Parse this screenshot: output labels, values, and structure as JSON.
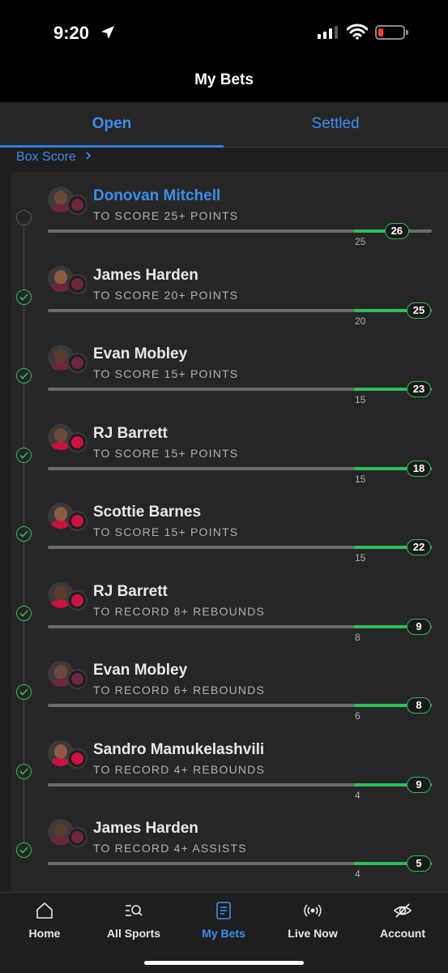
{
  "status_bar": {
    "time": "9:20"
  },
  "header": {
    "title": "My Bets"
  },
  "tabs": [
    {
      "label": "Open",
      "active": true
    },
    {
      "label": "Settled",
      "active": false
    }
  ],
  "box_score_link": "Box Score",
  "legs": [
    {
      "player": "Donovan Mitchell",
      "prop": "TO SCORE 25+ POINTS",
      "target": "25",
      "actual": "26",
      "status": "in-progress",
      "team": "Cavaliers",
      "team_color": "#6f263d",
      "progress": 0.55
    },
    {
      "player": "James Harden",
      "prop": "TO SCORE 20+ POINTS",
      "target": "20",
      "actual": "25",
      "status": "won",
      "team": "Cavaliers",
      "team_color": "#6f263d",
      "progress": 1
    },
    {
      "player": "Evan Mobley",
      "prop": "TO SCORE 15+ POINTS",
      "target": "15",
      "actual": "23",
      "status": "won",
      "team": "Cavaliers",
      "team_color": "#6f263d",
      "progress": 1
    },
    {
      "player": "RJ Barrett",
      "prop": "TO SCORE 15+ POINTS",
      "target": "15",
      "actual": "18",
      "status": "won",
      "team": "Raptors",
      "team_color": "#ce1141",
      "progress": 1
    },
    {
      "player": "Scottie Barnes",
      "prop": "TO SCORE 15+ POINTS",
      "target": "15",
      "actual": "22",
      "status": "won",
      "team": "Raptors",
      "team_color": "#ce1141",
      "progress": 1
    },
    {
      "player": "RJ Barrett",
      "prop": "TO RECORD 8+ REBOUNDS",
      "target": "8",
      "actual": "9",
      "status": "won",
      "team": "Raptors",
      "team_color": "#ce1141",
      "progress": 0.9
    },
    {
      "player": "Evan Mobley",
      "prop": "TO RECORD 6+ REBOUNDS",
      "target": "6",
      "actual": "8",
      "status": "won",
      "team": "Cavaliers",
      "team_color": "#6f263d",
      "progress": 1
    },
    {
      "player": "Sandro Mamukelashvili",
      "prop": "TO RECORD 4+ REBOUNDS",
      "target": "4",
      "actual": "9",
      "status": "won",
      "team": "Raptors",
      "team_color": "#ce1141",
      "progress": 1
    },
    {
      "player": "James Harden",
      "prop": "TO RECORD 4+ ASSISTS",
      "target": "4",
      "actual": "5",
      "status": "won",
      "team": "Cavaliers",
      "team_color": "#6f263d",
      "progress": 1
    }
  ],
  "bottom_nav": [
    {
      "label": "Home",
      "icon": "home-icon",
      "active": false
    },
    {
      "label": "All Sports",
      "icon": "search-list-icon",
      "active": false
    },
    {
      "label": "My Bets",
      "icon": "bet-slip-icon",
      "active": true
    },
    {
      "label": "Live Now",
      "icon": "live-broadcast-icon",
      "active": false
    },
    {
      "label": "Account",
      "icon": "eye-off-icon",
      "active": false
    }
  ],
  "colors": {
    "accent": "#3b8ef0",
    "win": "#2ebd59",
    "bg": "#1e1e1e"
  }
}
